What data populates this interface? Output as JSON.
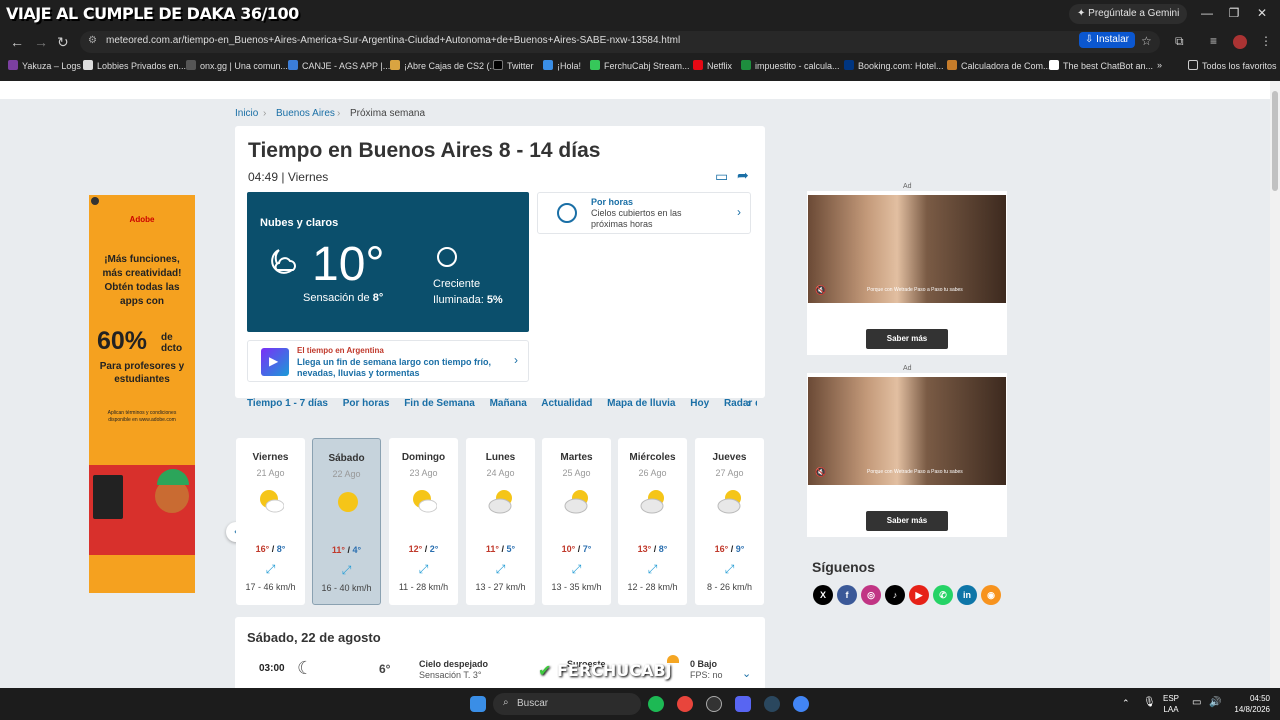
{
  "browser": {
    "overlay_title": "VIAJE AL CUMPLE DE DAKA 36/100",
    "gemini_button": "Pregúntale a Gemini",
    "url": "meteored.com.ar/tiempo-en_Buenos+Aires-America+Sur-Argentina-Ciudad+Autonoma+de+Buenos+Aires-SABE-nxw-13584.html",
    "install_button": "Instalar",
    "bookmarks": [
      "Yakuza – Logs",
      "Lobbies Privados en...",
      "onx.gg | Una comun...",
      "CANJE - AGS APP |...",
      "¡Abre Cajas de CS2 (...",
      "Twitter",
      "¡Hola!",
      "FerchuCabj Stream...",
      "Netflix",
      "impuestito - calcula...",
      "Booking.com: Hotel...",
      "Calculadora de Com...",
      "The best ChatBot an..."
    ],
    "all_bookmarks": "Todos los favoritos"
  },
  "breadcrumb": {
    "home": "Inicio",
    "city": "Buenos Aires",
    "current": "Próxima semana"
  },
  "main": {
    "title": "Tiempo en Buenos Aires 8 - 14 días",
    "time": "04:49",
    "day": "Viernes",
    "now": {
      "desc": "Nubes y claros",
      "temp": "10°",
      "feels_label": "Sensación de ",
      "feels_value": "8°",
      "moon_phase": "Creciente",
      "moon_ill_label": "Iluminada: ",
      "moon_ill_value": "5%"
    },
    "hourly": {
      "title": "Por horas",
      "text": "Cielos cubiertos en las próximas horas"
    },
    "promo": {
      "kicker": "El tiempo en Argentina",
      "text": "Llega un fin de semana largo con tiempo frío, nevadas, lluvias y tormentas"
    },
    "tabs": [
      "Tiempo 1 - 7 días",
      "Por horas",
      "Fin de Semana",
      "Mañana",
      "Actualidad",
      "Mapa de lluvia",
      "Hoy",
      "Radar de lluvia"
    ]
  },
  "days": [
    {
      "name": "Viernes",
      "date": "21 Ago",
      "max": "16°",
      "min": "8°",
      "wind": "17 - 46 km/h",
      "icon": "partly-cloudy-icon"
    },
    {
      "name": "Sábado",
      "date": "22 Ago",
      "max": "11°",
      "min": "4°",
      "wind": "16 - 40 km/h",
      "icon": "sun-icon"
    },
    {
      "name": "Domingo",
      "date": "23 Ago",
      "max": "12°",
      "min": "2°",
      "wind": "11 - 28 km/h",
      "icon": "partly-cloudy-icon"
    },
    {
      "name": "Lunes",
      "date": "24 Ago",
      "max": "11°",
      "min": "5°",
      "wind": "13 - 27 km/h",
      "icon": "cloudy-sun-icon"
    },
    {
      "name": "Martes",
      "date": "25 Ago",
      "max": "10°",
      "min": "7°",
      "wind": "13 - 35 km/h",
      "icon": "cloudy-sun-icon"
    },
    {
      "name": "Miércoles",
      "date": "26 Ago",
      "max": "13°",
      "min": "8°",
      "wind": "12 - 28 km/h",
      "icon": "cloudy-sun-icon"
    },
    {
      "name": "Jueves",
      "date": "27 Ago",
      "max": "16°",
      "min": "9°",
      "wind": "8 - 26 km/h",
      "icon": "cloudy-sun-icon"
    }
  ],
  "detail": {
    "heading": "Sábado, 22 de agosto",
    "row": {
      "time": "03:00",
      "temp": "6°",
      "sky": "Cielo despejado",
      "feels": "Sensación T. 3°",
      "wind_dir": "Suroeste",
      "uv": "0 Bajo",
      "fps": "FPS: no"
    }
  },
  "ads": {
    "left": {
      "brand": "Adobe",
      "headline": "¡Más funciones, más creatividad! Obtén todas las apps con",
      "big": "60%",
      "big_suffix": "de dcto",
      "sub": "Para profesores y estudiantes",
      "fine": "Aplican términos y condiciones disponible en www.adobe.com"
    },
    "label": "Ad",
    "button": "Saber más",
    "caption": "Porque con Wetrade Paso a Paso tu sabes"
  },
  "social": {
    "title": "Síguenos"
  },
  "streamer": "FERCHUCABJ",
  "taskbar": {
    "search": "Buscar",
    "lang": "ESP",
    "lang2": "LAA",
    "time": "04:50",
    "date": "14/8/2026"
  }
}
